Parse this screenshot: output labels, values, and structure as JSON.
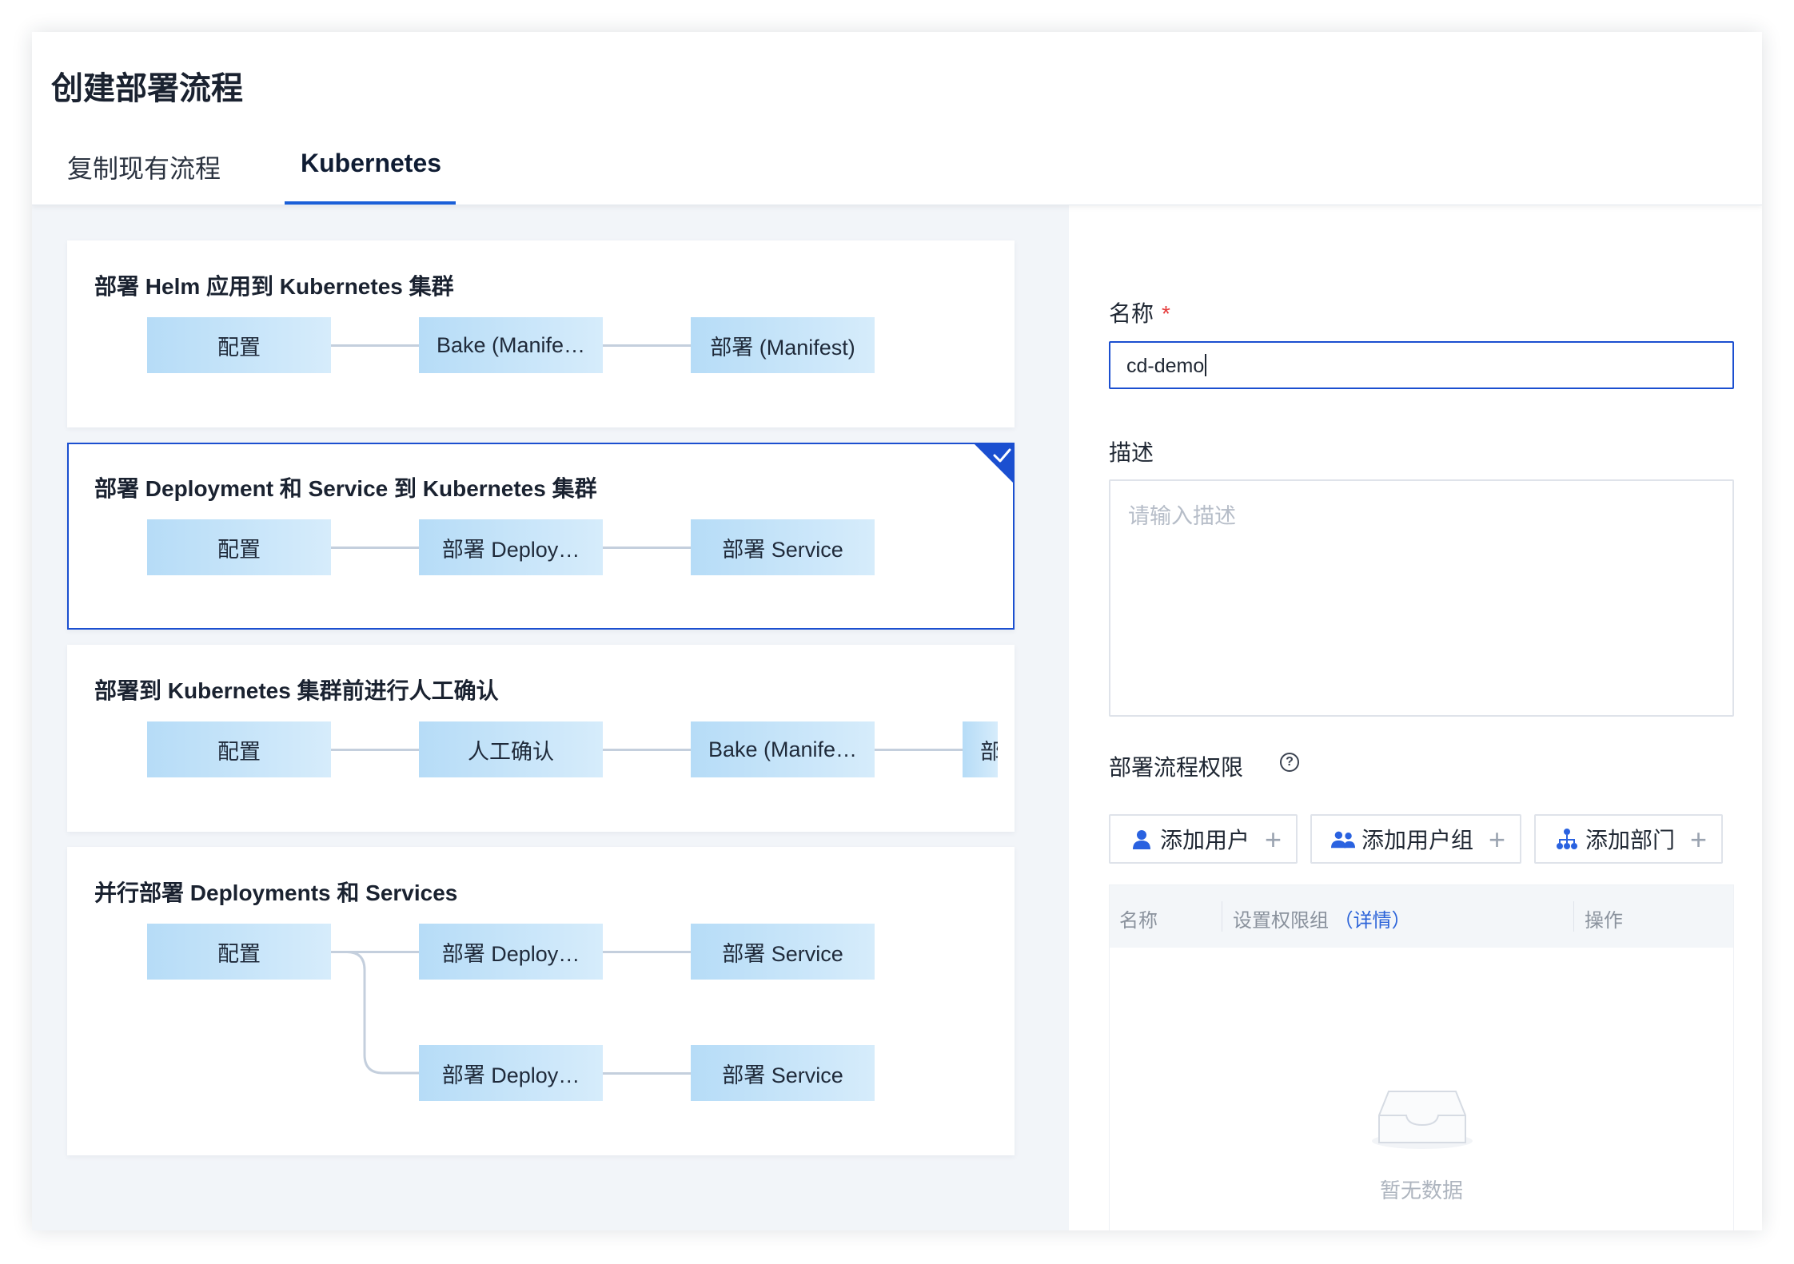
{
  "dialog": {
    "title": "创建部署流程",
    "tabs": [
      {
        "label": "复制现有流程",
        "active": false
      },
      {
        "label": "Kubernetes",
        "active": true
      }
    ]
  },
  "templates": [
    {
      "title": "部署 Helm 应用到 Kubernetes 集群",
      "selected": false,
      "nodes": [
        "配置",
        "Bake (Manife…",
        "部署 (Manifest)"
      ]
    },
    {
      "title": "部署 Deployment 和 Service 到 Kubernetes 集群",
      "selected": true,
      "nodes": [
        "配置",
        "部署 Deploy…",
        "部署 Service"
      ]
    },
    {
      "title": "部署到 Kubernetes 集群前进行人工确认",
      "selected": false,
      "nodes": [
        "配置",
        "人工确认",
        "Bake (Manife…",
        "部"
      ]
    },
    {
      "title": "并行部署 Deployments 和 Services",
      "selected": false,
      "nodes": [
        "配置",
        "部署 Deploy…",
        "部署 Service",
        "部署 Deploy…",
        "部署 Service"
      ]
    }
  ],
  "form": {
    "name_label": "名称",
    "required_mark": "*",
    "name_value": "cd-demo",
    "desc_label": "描述",
    "desc_placeholder": "请输入描述",
    "perm_label": "部署流程权限",
    "help_glyph": "?",
    "buttons": [
      {
        "label": "添加用户",
        "icon": "user-icon"
      },
      {
        "label": "添加用户组",
        "icon": "user-group-icon"
      },
      {
        "label": "添加部门",
        "icon": "department-icon"
      }
    ],
    "plus_glyph": "+",
    "table": {
      "col_name": "名称",
      "col_group": "设置权限组",
      "col_group_link": "（详情）",
      "col_action": "操作",
      "empty_text": "暂无数据"
    }
  },
  "colors": {
    "accent": "#1b4fd0",
    "required": "#e53a3a",
    "link": "#2b63d9"
  }
}
